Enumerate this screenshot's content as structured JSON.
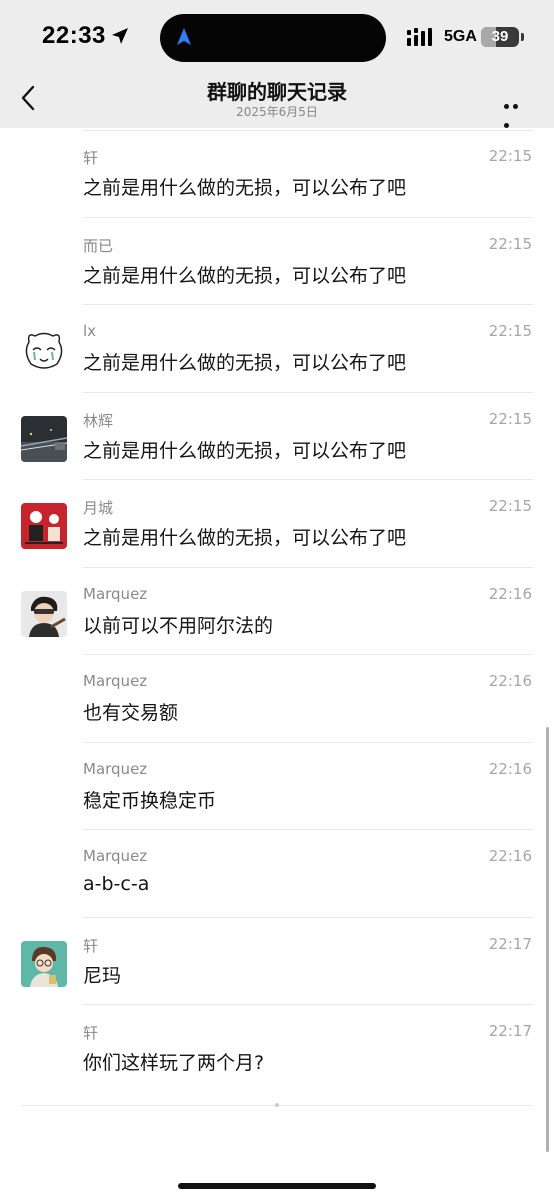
{
  "status": {
    "time": "22:33",
    "network": "5GA",
    "battery": "39",
    "battery_level": 0.39,
    "icons": [
      "location-arrow-icon",
      "navigation-icon",
      "signal-icon",
      "battery-icon"
    ]
  },
  "header": {
    "title": "群聊的聊天记录",
    "subtitle": "2025年6月5日",
    "back_icon": "chevron-left-icon",
    "more_icon": "more-dots-icon"
  },
  "messages": [
    {
      "name": "轩",
      "time": "22:15",
      "text": "之前是用什么做的无损，可以公布了吧",
      "avatar": null
    },
    {
      "name": "而已",
      "time": "22:15",
      "text": "之前是用什么做的无损，可以公布了吧",
      "avatar": null
    },
    {
      "name": "lx",
      "time": "22:15",
      "text": "之前是用什么做的无损，可以公布了吧",
      "avatar": "cartoon-face"
    },
    {
      "name": "林辉",
      "time": "22:15",
      "text": "之前是用什么做的无损，可以公布了吧",
      "avatar": "night-photo"
    },
    {
      "name": "月城",
      "time": "22:15",
      "text": "之前是用什么做的无损，可以公布了吧",
      "avatar": "red-illustration"
    },
    {
      "name": "Marquez",
      "time": "22:16",
      "text": "以前可以不用阿尔法的",
      "avatar": "anime-character"
    },
    {
      "name": "Marquez",
      "time": "22:16",
      "text": "也有交易额",
      "avatar": null
    },
    {
      "name": "Marquez",
      "time": "22:16",
      "text": "稳定币换稳定币",
      "avatar": null
    },
    {
      "name": "Marquez",
      "time": "22:16",
      "text": "a-b-c-a",
      "avatar": null
    },
    {
      "name": "轩",
      "time": "22:17",
      "text": "尼玛",
      "avatar": "anime-boy-teal"
    },
    {
      "name": "轩",
      "time": "22:17",
      "text": "你们这样玩了两个月?",
      "avatar": null
    }
  ],
  "colors": {
    "header_bg": "#ededed",
    "name": "#8a8a8a",
    "time": "#a6a6a6",
    "text": "#151515",
    "divider": "#e9e9e9"
  }
}
